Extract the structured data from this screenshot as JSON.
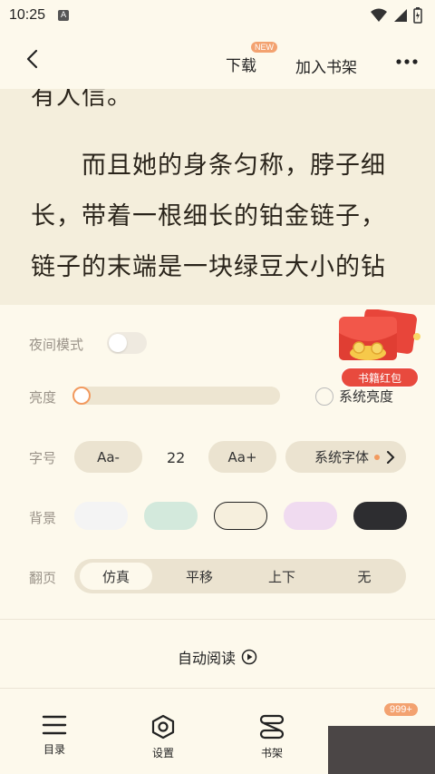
{
  "status_bar": {
    "time": "10:25",
    "notification_badge": "A"
  },
  "top_bar": {
    "download_label": "下载",
    "new_badge": "NEW",
    "add_shelf_label": "加入书架"
  },
  "reading": {
    "lines": [
      "有人信。",
      "　　而且她的身条匀称，脖子细",
      "长，带着一根细长的铂金链子，",
      "链子的末端是一块绿豆大小的钻"
    ]
  },
  "settings": {
    "night_mode_label": "夜间模式",
    "night_mode_on": false,
    "brightness_label": "亮度",
    "brightness_level": 0,
    "system_brightness_label": "系统亮度",
    "font_size_label": "字号",
    "font_decrease_label": "Aa-",
    "font_size_value": "22",
    "font_increase_label": "Aa+",
    "system_font_label": "系统字体",
    "background_label": "背景",
    "backgrounds": [
      "#F4F4F4",
      "#D3E9DC",
      "#F6EFDD",
      "#F0DBF0",
      "#2D2D30"
    ],
    "selected_background": 2,
    "page_flip_label": "翻页",
    "flip_options": [
      "仿真",
      "平移",
      "上下",
      "无"
    ],
    "selected_flip": 0,
    "auto_read_label": "自动阅读"
  },
  "promo": {
    "label": "书籍红包"
  },
  "bottom_nav": {
    "toc_label": "目录",
    "settings_label": "设置",
    "shelf_label": "书架",
    "badge": "999+"
  },
  "colors": {
    "accent": "#F29A5F",
    "page_bg": "#FDF9EC",
    "reading_bg": "#F4EEDC",
    "pill_bg": "#EBE3D0"
  }
}
